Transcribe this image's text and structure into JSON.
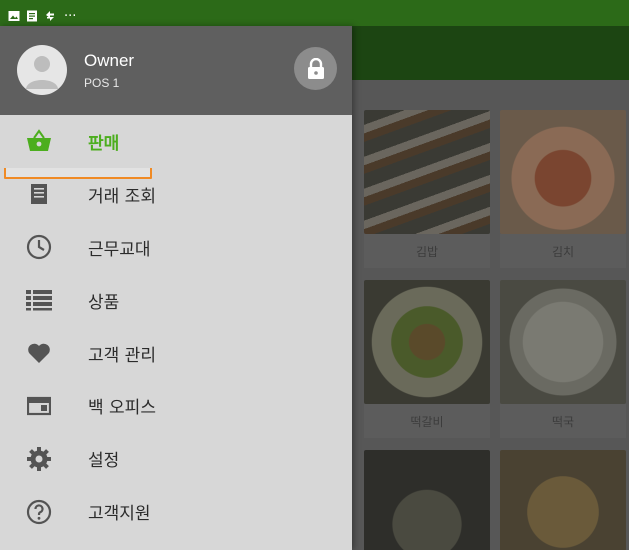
{
  "status_bar": {
    "icons": [
      "image-icon",
      "document-icon",
      "sync-icon"
    ],
    "overflow": "..."
  },
  "drawer": {
    "user": {
      "name": "Owner",
      "sub": "POS 1"
    },
    "lock_icon": "lock-icon",
    "items": [
      {
        "label": "판매",
        "icon": "basket-icon",
        "active": true
      },
      {
        "label": "거래 조회",
        "icon": "receipt-icon",
        "active": false
      },
      {
        "label": "근무교대",
        "icon": "clock-icon",
        "active": false
      },
      {
        "label": "상품",
        "icon": "list-icon",
        "active": false
      },
      {
        "label": "고객 관리",
        "icon": "heart-icon",
        "active": false
      },
      {
        "label": "백 오피스",
        "icon": "backoffice-icon",
        "active": false
      },
      {
        "label": "설정",
        "icon": "gear-icon",
        "active": false
      },
      {
        "label": "고객지원",
        "icon": "help-icon",
        "active": false
      }
    ]
  },
  "background": {
    "products": [
      {
        "label": "김밥"
      },
      {
        "label": "김치"
      },
      {
        "label": "떡갈비"
      },
      {
        "label": "떡국"
      }
    ]
  },
  "colors": {
    "status_bar": "#2c6a18",
    "accent": "#4cae1e",
    "highlight": "#f08a24",
    "drawer_header": "#5f5f5f"
  }
}
